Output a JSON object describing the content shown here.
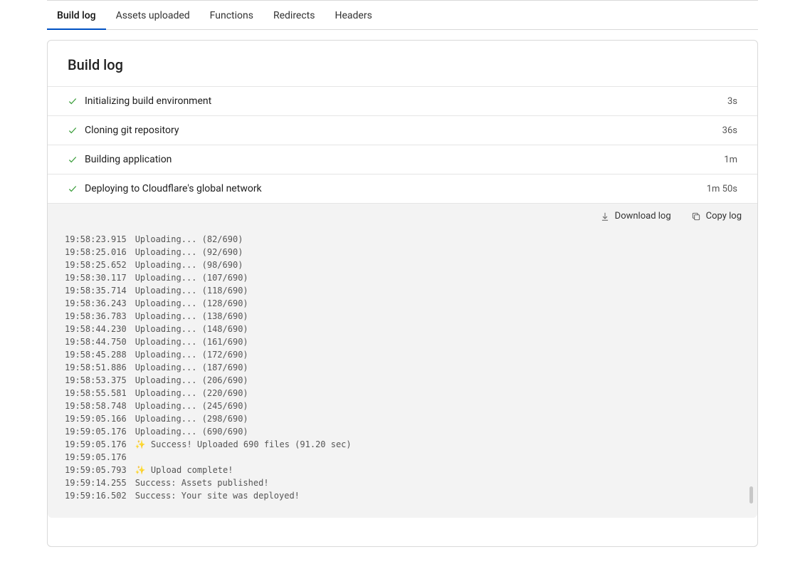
{
  "tabs": [
    {
      "label": "Build log",
      "active": true
    },
    {
      "label": "Assets uploaded",
      "active": false
    },
    {
      "label": "Functions",
      "active": false
    },
    {
      "label": "Redirects",
      "active": false
    },
    {
      "label": "Headers",
      "active": false
    }
  ],
  "card_title": "Build log",
  "stages": [
    {
      "label": "Initializing build environment",
      "duration": "3s"
    },
    {
      "label": "Cloning git repository",
      "duration": "36s"
    },
    {
      "label": "Building application",
      "duration": "1m"
    },
    {
      "label": "Deploying to Cloudflare's global network",
      "duration": "1m 50s"
    }
  ],
  "actions": {
    "download": "Download log",
    "copy": "Copy log"
  },
  "log_lines": [
    {
      "ts": "19:58:23.915",
      "spark": false,
      "msg": "Uploading... (82/690)"
    },
    {
      "ts": "19:58:25.016",
      "spark": false,
      "msg": "Uploading... (92/690)"
    },
    {
      "ts": "19:58:25.652",
      "spark": false,
      "msg": "Uploading... (98/690)"
    },
    {
      "ts": "19:58:30.117",
      "spark": false,
      "msg": "Uploading... (107/690)"
    },
    {
      "ts": "19:58:35.714",
      "spark": false,
      "msg": "Uploading... (118/690)"
    },
    {
      "ts": "19:58:36.243",
      "spark": false,
      "msg": "Uploading... (128/690)"
    },
    {
      "ts": "19:58:36.783",
      "spark": false,
      "msg": "Uploading... (138/690)"
    },
    {
      "ts": "19:58:44.230",
      "spark": false,
      "msg": "Uploading... (148/690)"
    },
    {
      "ts": "19:58:44.750",
      "spark": false,
      "msg": "Uploading... (161/690)"
    },
    {
      "ts": "19:58:45.288",
      "spark": false,
      "msg": "Uploading... (172/690)"
    },
    {
      "ts": "19:58:51.886",
      "spark": false,
      "msg": "Uploading... (187/690)"
    },
    {
      "ts": "19:58:53.375",
      "spark": false,
      "msg": "Uploading... (206/690)"
    },
    {
      "ts": "19:58:55.581",
      "spark": false,
      "msg": "Uploading... (220/690)"
    },
    {
      "ts": "19:58:58.748",
      "spark": false,
      "msg": "Uploading... (245/690)"
    },
    {
      "ts": "19:59:05.166",
      "spark": false,
      "msg": "Uploading... (298/690)"
    },
    {
      "ts": "19:59:05.176",
      "spark": false,
      "msg": "Uploading... (690/690)"
    },
    {
      "ts": "19:59:05.176",
      "spark": true,
      "msg": "Success! Uploaded 690 files (91.20 sec)"
    },
    {
      "ts": "19:59:05.176",
      "spark": false,
      "msg": ""
    },
    {
      "ts": "19:59:05.793",
      "spark": true,
      "msg": "Upload complete!"
    },
    {
      "ts": "19:59:14.255",
      "spark": false,
      "msg": "Success: Assets published!"
    },
    {
      "ts": "19:59:16.502",
      "spark": false,
      "msg": "Success: Your site was deployed!"
    }
  ]
}
